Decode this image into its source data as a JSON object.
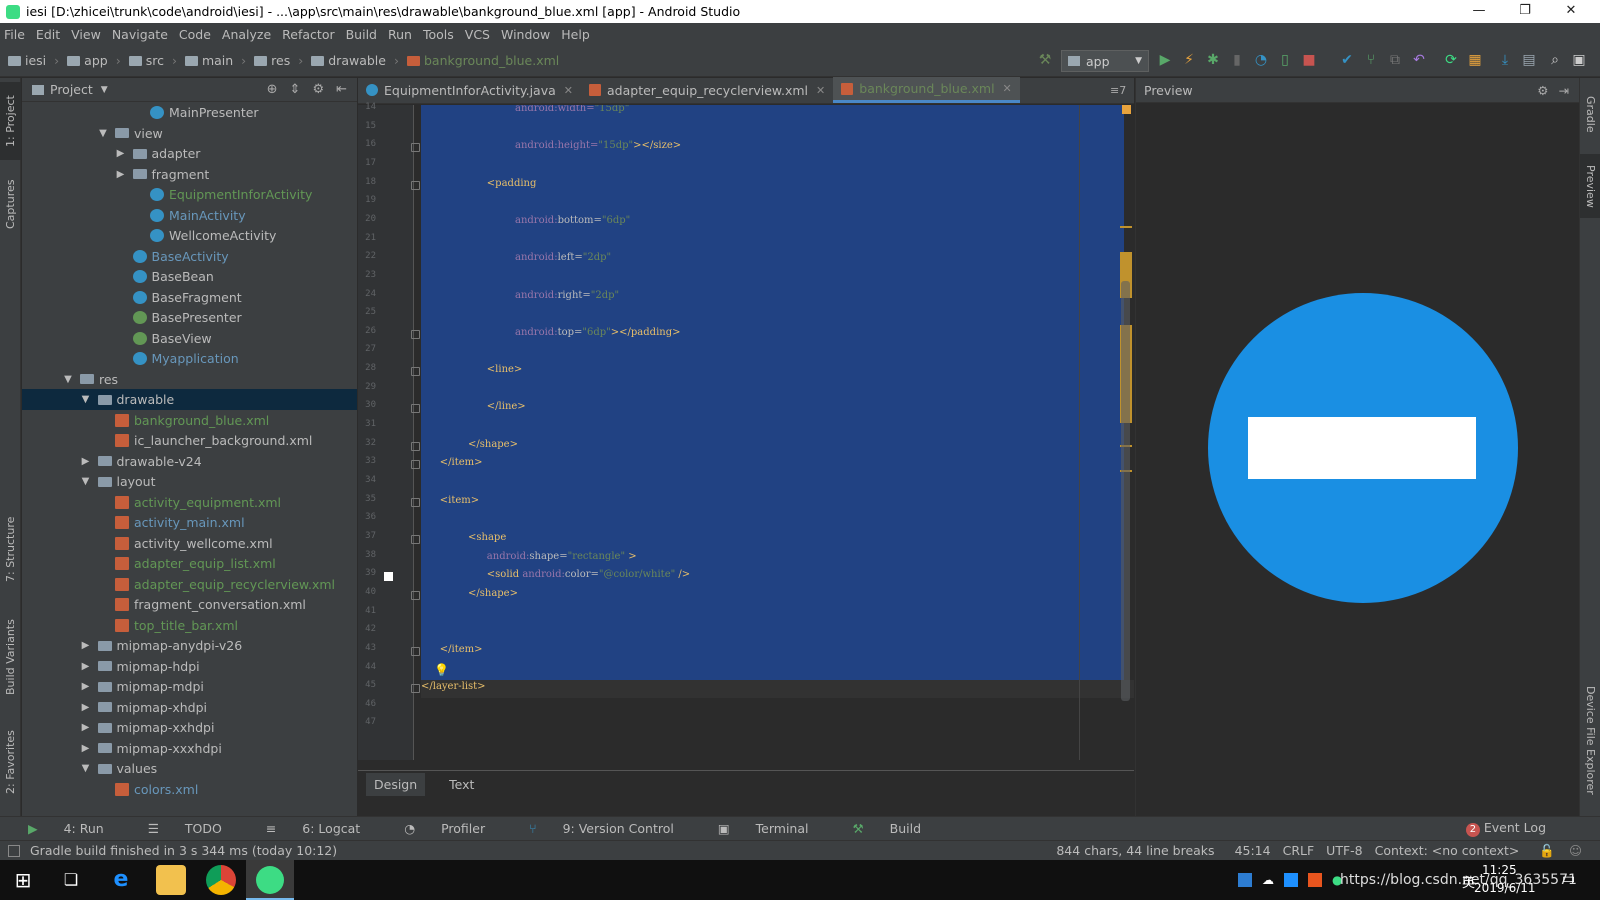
{
  "window": {
    "title": "iesi [D:\\zhicei\\trunk\\code\\android\\iesi] - ...\\app\\src\\main\\res\\drawable\\bankground_blue.xml [app] - Android Studio",
    "minimize": "—",
    "maximize": "❐",
    "close": "✕"
  },
  "menu": [
    "File",
    "Edit",
    "View",
    "Navigate",
    "Code",
    "Analyze",
    "Refactor",
    "Build",
    "Run",
    "Tools",
    "VCS",
    "Window",
    "Help"
  ],
  "breadcrumbs": [
    "iesi",
    "app",
    "src",
    "main",
    "res",
    "drawable",
    "bankground_blue.xml"
  ],
  "run_config": "app",
  "left_tool_tabs": [
    "1: Project",
    "Captures",
    "7: Structure",
    "Build Variants",
    "2: Favorites"
  ],
  "right_tool_tabs": [
    "Gradle",
    "Preview",
    "Device File Explorer"
  ],
  "project_panel": {
    "title": "Project",
    "tree": [
      {
        "label": "MainPresenter",
        "icon": "class",
        "indent": 8,
        "color": "norm",
        "arrow": ""
      },
      {
        "label": "view",
        "icon": "folder",
        "indent": 6,
        "color": "norm",
        "arrow": "▼"
      },
      {
        "label": "adapter",
        "icon": "folder",
        "indent": 7,
        "color": "norm",
        "arrow": "▶"
      },
      {
        "label": "fragment",
        "icon": "folder",
        "indent": 7,
        "color": "norm",
        "arrow": "▶"
      },
      {
        "label": "EquipmentInforActivity",
        "icon": "class",
        "indent": 8,
        "color": "new",
        "arrow": ""
      },
      {
        "label": "MainActivity",
        "icon": "class",
        "indent": 8,
        "color": "mod",
        "arrow": ""
      },
      {
        "label": "WellcomeActivity",
        "icon": "class",
        "indent": 8,
        "color": "norm",
        "arrow": ""
      },
      {
        "label": "BaseActivity",
        "icon": "abs",
        "indent": 7,
        "color": "mod",
        "arrow": ""
      },
      {
        "label": "BaseBean",
        "icon": "class",
        "indent": 7,
        "color": "norm",
        "arrow": ""
      },
      {
        "label": "BaseFragment",
        "icon": "abs",
        "indent": 7,
        "color": "norm",
        "arrow": ""
      },
      {
        "label": "BasePresenter",
        "icon": "interface",
        "indent": 7,
        "color": "norm",
        "arrow": ""
      },
      {
        "label": "BaseView",
        "icon": "interface",
        "indent": 7,
        "color": "norm",
        "arrow": ""
      },
      {
        "label": "Myapplication",
        "icon": "class",
        "indent": 7,
        "color": "mod",
        "arrow": ""
      },
      {
        "label": "res",
        "icon": "folder",
        "indent": 4,
        "color": "norm",
        "arrow": "▼"
      },
      {
        "label": "drawable",
        "icon": "folder",
        "indent": 5,
        "color": "norm",
        "arrow": "▼",
        "selected": true
      },
      {
        "label": "bankground_blue.xml",
        "icon": "xml",
        "indent": 6,
        "color": "new",
        "arrow": ""
      },
      {
        "label": "ic_launcher_background.xml",
        "icon": "xml",
        "indent": 6,
        "color": "norm",
        "arrow": ""
      },
      {
        "label": "drawable-v24",
        "icon": "folder",
        "indent": 5,
        "color": "norm",
        "arrow": "▶"
      },
      {
        "label": "layout",
        "icon": "folder",
        "indent": 5,
        "color": "norm",
        "arrow": "▼"
      },
      {
        "label": "activity_equipment.xml",
        "icon": "xml",
        "indent": 6,
        "color": "new",
        "arrow": ""
      },
      {
        "label": "activity_main.xml",
        "icon": "xml",
        "indent": 6,
        "color": "mod",
        "arrow": ""
      },
      {
        "label": "activity_wellcome.xml",
        "icon": "xml",
        "indent": 6,
        "color": "norm",
        "arrow": ""
      },
      {
        "label": "adapter_equip_list.xml",
        "icon": "xml",
        "indent": 6,
        "color": "new",
        "arrow": ""
      },
      {
        "label": "adapter_equip_recyclerview.xml",
        "icon": "xml",
        "indent": 6,
        "color": "new",
        "arrow": ""
      },
      {
        "label": "fragment_conversation.xml",
        "icon": "xml",
        "indent": 6,
        "color": "norm",
        "arrow": ""
      },
      {
        "label": "top_title_bar.xml",
        "icon": "xml",
        "indent": 6,
        "color": "new",
        "arrow": ""
      },
      {
        "label": "mipmap-anydpi-v26",
        "icon": "folder",
        "indent": 5,
        "color": "norm",
        "arrow": "▶"
      },
      {
        "label": "mipmap-hdpi",
        "icon": "folder",
        "indent": 5,
        "color": "norm",
        "arrow": "▶"
      },
      {
        "label": "mipmap-mdpi",
        "icon": "folder",
        "indent": 5,
        "color": "norm",
        "arrow": "▶"
      },
      {
        "label": "mipmap-xhdpi",
        "icon": "folder",
        "indent": 5,
        "color": "norm",
        "arrow": "▶"
      },
      {
        "label": "mipmap-xxhdpi",
        "icon": "folder",
        "indent": 5,
        "color": "norm",
        "arrow": "▶"
      },
      {
        "label": "mipmap-xxxhdpi",
        "icon": "folder",
        "indent": 5,
        "color": "norm",
        "arrow": "▶"
      },
      {
        "label": "values",
        "icon": "folder",
        "indent": 5,
        "color": "norm",
        "arrow": "▼"
      },
      {
        "label": "colors.xml",
        "icon": "xml",
        "indent": 6,
        "color": "mod",
        "arrow": ""
      }
    ]
  },
  "editor": {
    "tabs": [
      {
        "label": "EquipmentInforActivity.java",
        "kind": "java",
        "active": false
      },
      {
        "label": "adapter_equip_recyclerview.xml",
        "kind": "xml",
        "active": false
      },
      {
        "label": "bankground_blue.xml",
        "kind": "xml",
        "active": true
      }
    ],
    "tabs_overflow": "≡7",
    "first_line": 14,
    "lines": [
      [
        [
          "a",
          "android:"
        ],
        [
          "a",
          "width="
        ],
        [
          "v",
          "\"15dp\""
        ]
      ],
      [],
      [
        [
          "a",
          "android:"
        ],
        [
          "a",
          "height="
        ],
        [
          "v",
          "\"15dp\""
        ],
        [
          "t",
          "></size>"
        ]
      ],
      [],
      [
        [
          "t",
          "<padding"
        ]
      ],
      [],
      [
        [
          "a",
          "android:"
        ],
        [
          "p",
          "bottom="
        ],
        [
          "v",
          "\"6dp\""
        ]
      ],
      [],
      [
        [
          "a",
          "android:"
        ],
        [
          "p",
          "left="
        ],
        [
          "v",
          "\"2dp\""
        ]
      ],
      [],
      [
        [
          "a",
          "android:"
        ],
        [
          "p",
          "right="
        ],
        [
          "v",
          "\"2dp\""
        ]
      ],
      [],
      [
        [
          "a",
          "android:"
        ],
        [
          "p",
          "top="
        ],
        [
          "v",
          "\"6dp\""
        ],
        [
          "t",
          "></padding>"
        ]
      ],
      [],
      [
        [
          "t",
          "<line>"
        ]
      ],
      [],
      [
        [
          "t",
          "</line>"
        ]
      ],
      [],
      [
        [
          "t",
          "</shape>"
        ]
      ],
      [
        [
          "t",
          "</item>"
        ]
      ],
      [],
      [
        [
          "t",
          "<item>"
        ]
      ],
      [],
      [
        [
          "t",
          "<shape"
        ]
      ],
      [
        [
          "a",
          "android:"
        ],
        [
          "p",
          "shape="
        ],
        [
          "v",
          "\"rectangle\""
        ],
        [
          "t",
          " >"
        ]
      ],
      [
        [
          "t",
          "<solid "
        ],
        [
          "a",
          "android:"
        ],
        [
          "p",
          "color="
        ],
        [
          "v",
          "\"@color/white\""
        ],
        [
          "t",
          " />"
        ]
      ],
      [
        [
          "t",
          "</shape>"
        ]
      ],
      [],
      [],
      [
        [
          "t",
          "</item>"
        ]
      ],
      [],
      [
        [
          "t",
          "</layer-list>"
        ]
      ],
      [],
      []
    ],
    "bottom_tabs": [
      "Design",
      "Text"
    ]
  },
  "preview": {
    "title": "Preview",
    "shape_color": "#1a8fe3",
    "bar_color": "#ffffff"
  },
  "tool_windows": [
    "4: Run",
    "TODO",
    "6: Logcat",
    "Profiler",
    "9: Version Control",
    "Terminal",
    "Build",
    "Event Log"
  ],
  "event_log_count": "2",
  "status": {
    "message": "Gradle build finished in 3 s 344 ms (today 10:12)",
    "chars": "844 chars, 44 line breaks",
    "position": "45:14",
    "line_sep": "CRLF",
    "encoding": "UTF-8",
    "context": "Context: <no context>"
  },
  "taskbar": {
    "time": "11:25",
    "date": "2019/6/11",
    "watermark": "https://blog.csdn.net/qq_3635571",
    "ime": "英"
  }
}
